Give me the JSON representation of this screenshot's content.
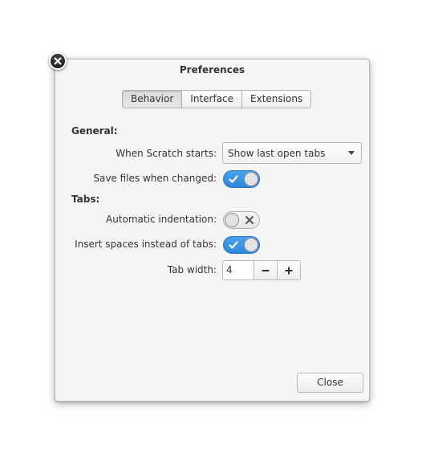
{
  "dialog": {
    "title": "Preferences"
  },
  "tabs": [
    {
      "label": "Behavior",
      "active": true
    },
    {
      "label": "Interface",
      "active": false
    },
    {
      "label": "Extensions",
      "active": false
    }
  ],
  "general": {
    "header": "General:",
    "scratch_starts_label": "When Scratch starts:",
    "scratch_starts_value": "Show last open tabs",
    "save_files_label": "Save files when changed:",
    "save_files_on": true
  },
  "tabs_section": {
    "header": "Tabs:",
    "auto_indent_label": "Automatic indentation:",
    "auto_indent_on": false,
    "insert_spaces_label": "Insert spaces instead of tabs:",
    "insert_spaces_on": true,
    "tab_width_label": "Tab width:",
    "tab_width_value": "4"
  },
  "footer": {
    "close_label": "Close"
  },
  "icons": {
    "window_close": "close-icon",
    "toggle_on": "check-icon",
    "toggle_off": "x-icon",
    "dropdown": "chevron-down-icon",
    "decrement": "minus-icon",
    "increment": "plus-icon"
  },
  "colors": {
    "accent": "#3d95e6",
    "dialog_bg": "#f5f5f5"
  }
}
